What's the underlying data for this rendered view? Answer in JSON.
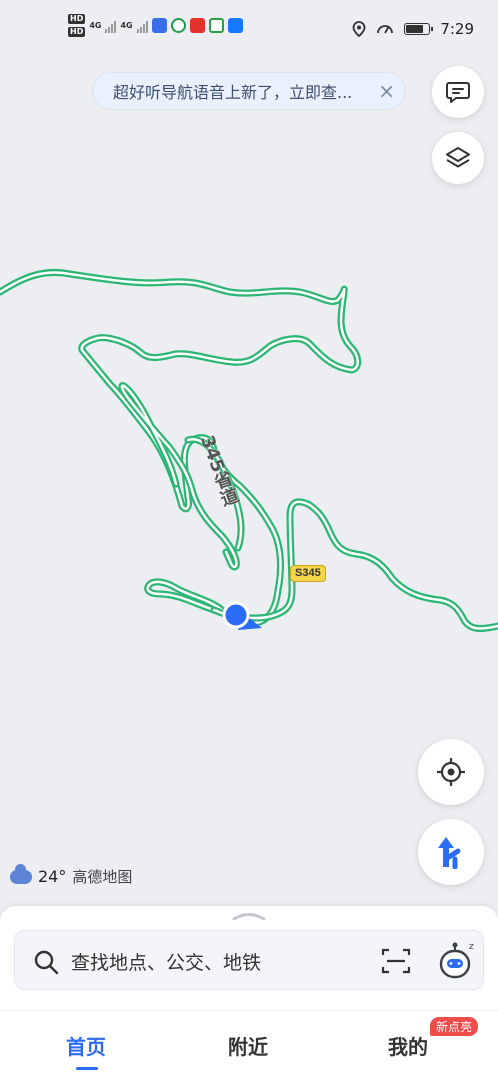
{
  "status_bar": {
    "time": "7:29",
    "network_1": "4G",
    "network_2": "4G",
    "hd_1": "HD",
    "hd_2": "HD"
  },
  "banner": {
    "text": "超好听导航语音上新了，立即查...",
    "close": "×"
  },
  "map": {
    "road_vertical_label": "345省道",
    "road_badge": "S345",
    "route_color": "#2bb673",
    "location_color": "#2b6cf6"
  },
  "weather": {
    "temperature": "24°",
    "logo": "高德地图"
  },
  "search": {
    "placeholder": "查找地点、公交、地铁"
  },
  "tabs": [
    {
      "label": "首页",
      "active": true
    },
    {
      "label": "附近",
      "active": false
    },
    {
      "label": "我的",
      "active": false
    }
  ],
  "my_badge": "新点亮",
  "colors": {
    "accent": "#2b6cf6",
    "route": "#2bb673",
    "badge": "#f04b4b",
    "road_shield": "#f7d548"
  }
}
